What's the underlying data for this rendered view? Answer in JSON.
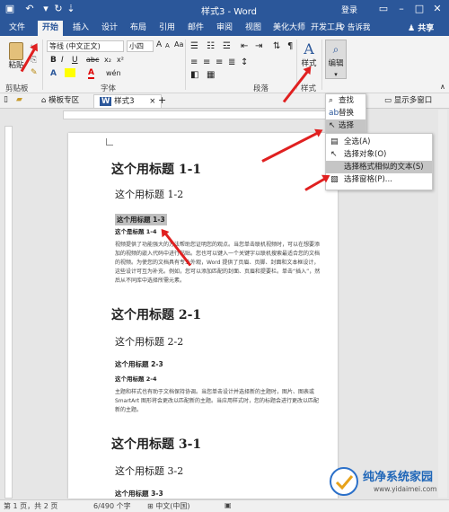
{
  "titlebar": {
    "title": "样式3 - Word",
    "login": "登录",
    "save_icon": "save-icon",
    "undo_icon": "undo-icon",
    "redo_icon": "redo-icon"
  },
  "tabs": [
    "文件",
    "开始",
    "插入",
    "设计",
    "布局",
    "引用",
    "邮件",
    "审阅",
    "视图",
    "美化大师",
    "开发工具"
  ],
  "tellme": "♀ 告诉我",
  "share": "共享",
  "ribbon": {
    "paste_label": "粘贴",
    "font_name": "等线 (中文正文)",
    "font_size": "小四",
    "clipboard_label": "剪贴板",
    "font_label": "字体",
    "paragraph_label": "段落",
    "style_label": "样式",
    "styles_group": "样式",
    "edit_label": "编辑",
    "bold": "B",
    "italic": "I",
    "underline": "U",
    "strike": "abc",
    "sub": "x₂",
    "sup": "x²",
    "color_a": "A",
    "wen": "wén",
    "aa": "Aa",
    "grow": "A",
    "shrink": "A",
    "fontA": "A"
  },
  "docstrip": {
    "tab1": "模板专区",
    "tab2": "样式3",
    "show_multi": "显示多窗口"
  },
  "edit_menu": {
    "find": "查找",
    "replace": "替换",
    "select": "选择"
  },
  "select_menu": {
    "items": [
      "全选(A)",
      "选择对象(O)",
      "选择格式相似的文本(S)",
      "选择窗格(P)..."
    ]
  },
  "document": {
    "h1_a": "这个用标题 1-1",
    "h2_a": "这个用标题 1-2",
    "h3_a": "这个用标题 1-3",
    "h4_a": "这个是标题 1-4",
    "para_a": "视频提供了功能强大的方法帮助您证明您的观点。当您单击联机视频时，可以在想要添加的视频的嵌入代码中进行粘贴。您也可以键入一个关键字以联机搜索最适合您的文档的视频。为使您的文档具有专业外观，Word 提供了页眉、页脚、封面和文本框设计，这些设计可互为补充。例如，您可以添加匹配的封面、页眉和提要栏。单击“插入”，然后从不同库中选择所需元素。",
    "h1_b": "这个用标题 2-1",
    "h2_b": "这个用标题 2-2",
    "h3_b": "这个用标题 2-3",
    "h4_b": "这个用标题 2-4",
    "para_b": "主题和样式也有助于文档保持协调。当您单击设计并选择新的主题时，图片、图表或 SmartArt 图形将会更改以匹配新的主题。当应用样式时，您的标题会进行更改以匹配新的主题。",
    "h1_c": "这个用标题 3-1",
    "h2_c": "这个用标题 3-2",
    "h3_c": "这个用标题 3-3"
  },
  "statusbar": {
    "page": "第 1 页，共 2 页",
    "words": "6/490 个字",
    "lang": "中文(中国)"
  },
  "watermark": {
    "brand": "纯净系统家园",
    "url": "www.yidaimei.com"
  },
  "colors": {
    "word_blue": "#2b579a",
    "arrow_red": "#e02020"
  }
}
